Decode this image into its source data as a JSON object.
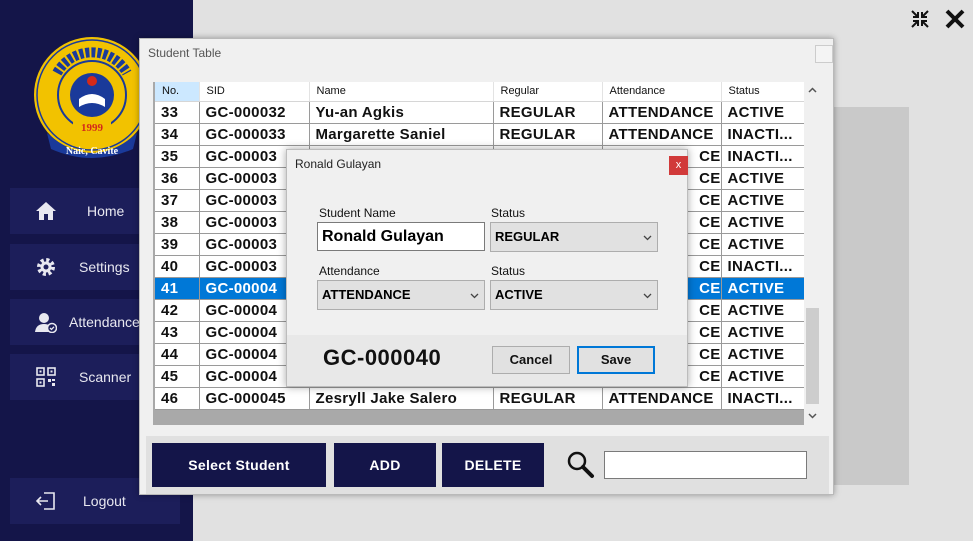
{
  "sidebar": {
    "logo": {
      "ring_text": "GRANBY COLLEGES OF SCIENCE AND TECHNOLOGY",
      "year": "1999",
      "location": "Naic, Cavite"
    },
    "items": [
      {
        "label": "Home",
        "icon": "home-icon"
      },
      {
        "label": "Settings",
        "icon": "gear-icon"
      },
      {
        "label": "Attendance",
        "icon": "user-check-icon"
      },
      {
        "label": "Scanner",
        "icon": "qr-code-icon"
      }
    ],
    "logout": {
      "label": "Logout",
      "icon": "logout-icon"
    }
  },
  "window_controls": {
    "minimize_icon": "collapse-icon",
    "close_icon": "close-icon"
  },
  "student_table": {
    "title": "Student Table",
    "columns": [
      "No.",
      "SID",
      "Name",
      "Regular",
      "Attendance",
      "Status"
    ],
    "rows": [
      {
        "no": "33",
        "sid": "GC-000032",
        "name": "Yu-an Agkis",
        "regular": "REGULAR",
        "attendance": "ATTENDANCE",
        "status": "ACTIVE"
      },
      {
        "no": "34",
        "sid": "GC-000033",
        "name": "Margarette Saniel",
        "regular": "REGULAR",
        "attendance": "ATTENDANCE",
        "status": "INACTI..."
      },
      {
        "no": "35",
        "sid": "GC-00003",
        "name": "",
        "regular": "",
        "attendance": "CE",
        "status": "INACTI..."
      },
      {
        "no": "36",
        "sid": "GC-00003",
        "name": "",
        "regular": "",
        "attendance": "CE",
        "status": "ACTIVE"
      },
      {
        "no": "37",
        "sid": "GC-00003",
        "name": "",
        "regular": "",
        "attendance": "CE",
        "status": "ACTIVE"
      },
      {
        "no": "38",
        "sid": "GC-00003",
        "name": "",
        "regular": "",
        "attendance": "CE",
        "status": "ACTIVE"
      },
      {
        "no": "39",
        "sid": "GC-00003",
        "name": "",
        "regular": "",
        "attendance": "CE",
        "status": "ACTIVE"
      },
      {
        "no": "40",
        "sid": "GC-00003",
        "name": "",
        "regular": "",
        "attendance": "CE",
        "status": "INACTI..."
      },
      {
        "no": "41",
        "sid": "GC-00004",
        "name": "",
        "regular": "",
        "attendance": "CE",
        "status": "ACTIVE"
      },
      {
        "no": "42",
        "sid": "GC-00004",
        "name": "",
        "regular": "",
        "attendance": "CE",
        "status": "ACTIVE"
      },
      {
        "no": "43",
        "sid": "GC-00004",
        "name": "",
        "regular": "",
        "attendance": "CE",
        "status": "ACTIVE"
      },
      {
        "no": "44",
        "sid": "GC-00004",
        "name": "",
        "regular": "",
        "attendance": "CE",
        "status": "ACTIVE"
      },
      {
        "no": "45",
        "sid": "GC-00004",
        "name": "",
        "regular": "",
        "attendance": "CE",
        "status": "ACTIVE"
      },
      {
        "no": "46",
        "sid": "GC-000045",
        "name": "Zesryll Jake Salero",
        "regular": "REGULAR",
        "attendance": "ATTENDANCE",
        "status": "INACTI..."
      }
    ],
    "selected_row_no": "41",
    "buttons": {
      "select_student": "Select Student",
      "add": "ADD",
      "delete": "DELETE"
    },
    "search": {
      "icon": "search-icon",
      "value": ""
    }
  },
  "dialog": {
    "title": "Ronald Gulayan",
    "close_label": "x",
    "student_name_label": "Student Name",
    "student_name_value": "Ronald Gulayan",
    "status_label_1": "Status",
    "status_value_1": "REGULAR",
    "attendance_label": "Attendance",
    "attendance_value": "ATTENDANCE",
    "status_label_2": "Status",
    "status_value_2": "ACTIVE",
    "sid": "GC-000040",
    "cancel_label": "Cancel",
    "save_label": "Save"
  },
  "colors": {
    "sidebar_bg": "#141549",
    "nav_button_bg": "#1c1e5a",
    "selection_blue": "#0078d7",
    "dialog_close_red": "#d13a3a"
  }
}
